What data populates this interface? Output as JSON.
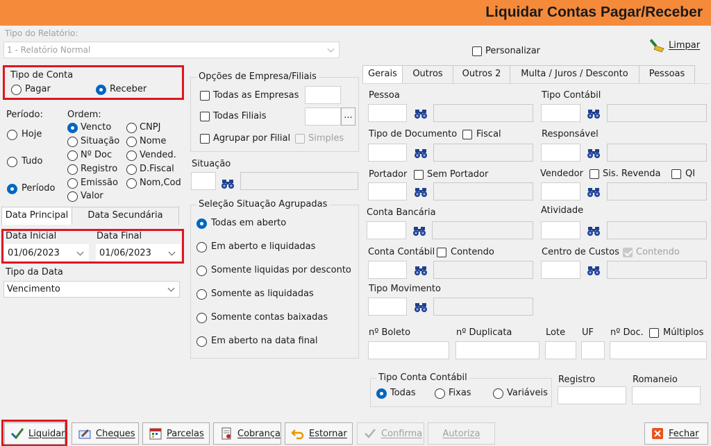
{
  "title": "Liquidar Contas Pagar/Receber",
  "tipo_relatorio": {
    "label": "Tipo do Relatório:",
    "value": "1 - Relatório Normal"
  },
  "personalizar": "Personalizar",
  "limpar": "Limpar",
  "tipo_conta": {
    "title": "Tipo de Conta",
    "pagar": "Pagar",
    "receber": "Receber",
    "selected": "Receber"
  },
  "periodo": {
    "label": "Período:",
    "hoje": "Hoje",
    "tudo": "Tudo",
    "periodo": "Período",
    "selected": "Período"
  },
  "ordem": {
    "label": "Ordem:",
    "items": [
      "Vencto",
      "CNPJ",
      "Situação",
      "Nome",
      "Nº Doc",
      "Vended.",
      "Registro",
      "D.Fiscal",
      "Emissão",
      "Nom,Cod",
      "Valor"
    ],
    "selected": "Vencto"
  },
  "data_tabs": {
    "principal": "Data Principal",
    "secundaria": "Data Secundária"
  },
  "data_inicial": {
    "label": "Data Inicial",
    "value": "01/06/2023"
  },
  "data_final": {
    "label": "Data Final",
    "value": "01/06/2023"
  },
  "tipo_data": {
    "label": "Tipo da Data",
    "value": "Vencimento"
  },
  "empresa": {
    "title": "Opções de Empresa/Filiais",
    "todas_empresas": "Todas as Empresas",
    "todas_filiais": "Todas Filiais",
    "agrupar": "Agrupar por Filial",
    "simples": "Simples",
    "ellipsis": "..."
  },
  "situacao": {
    "label": "Situação"
  },
  "selecao": {
    "title": "Seleção Situação Agrupadas",
    "options": [
      "Todas em aberto",
      "Em aberto e liquidadas",
      "Somente liquidas por desconto",
      "Somente as liquidadas",
      "Somente contas baixadas",
      "Em aberto na data final"
    ],
    "selected": "Todas em aberto"
  },
  "tabs": [
    "Gerais",
    "Outros",
    "Outros 2",
    "Multa / Juros / Desconto",
    "Pessoas"
  ],
  "gerais": {
    "pessoa": "Pessoa",
    "tipo_contabil": "Tipo Contábil",
    "tipo_documento": "Tipo de Documento",
    "fiscal": "Fiscal",
    "responsavel": "Responsável",
    "portador": "Portador",
    "sem_portador": "Sem Portador",
    "vendedor": "Vendedor",
    "sis_revenda": "Sis. Revenda",
    "qi": "QI",
    "conta_bancaria": "Conta Bancária",
    "atividade": "Atividade",
    "conta_contabil": "Conta Contábil",
    "contendo": "Contendo",
    "centro_custos": "Centro de Custos",
    "contendo2": "Contendo",
    "tipo_movimento": "Tipo Movimento",
    "n_boleto": "nº Boleto",
    "n_duplicata": "nº Duplicata",
    "lote": "Lote",
    "uf": "UF",
    "n_doc": "nº Doc.",
    "multiplos": "Múltiplos",
    "tipo_conta_contabil": {
      "title": "Tipo Conta Contábil",
      "todas": "Todas",
      "fixas": "Fixas",
      "variaveis": "Variáveis",
      "selected": "Todas"
    },
    "registro": "Registro",
    "romaneio": "Romaneio"
  },
  "buttons": {
    "liquidar": "Liquidar",
    "cheques": "Cheques",
    "parcelas": "Parcelas",
    "cobranca": "Cobrança",
    "estornar": "Estornar",
    "confirma": "Confirma",
    "autoriza": "Autoriza",
    "fechar": "Fechar"
  },
  "colors": {
    "titlebar": "#f58b3a",
    "highlight": "#e0141e",
    "accent": "#0067c0"
  }
}
